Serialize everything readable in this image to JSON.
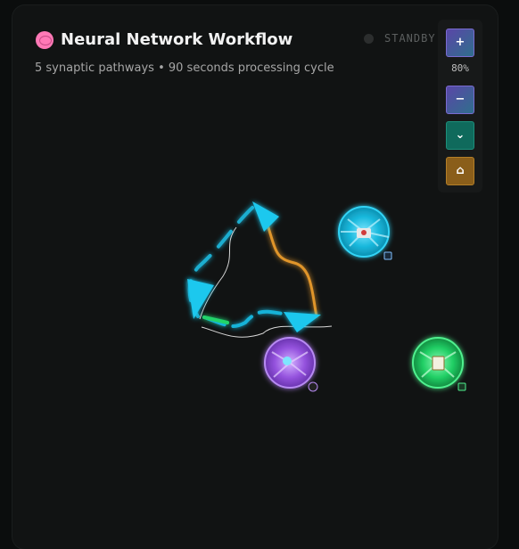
{
  "header": {
    "icon": "brain-icon",
    "title": "Neural Network Workflow",
    "subtitle": "5 synaptic pathways • 90 seconds processing cycle"
  },
  "status": {
    "label": "STANDBY",
    "dot_color": "#2c2e2e"
  },
  "zoom": {
    "zoom_in_label": "+",
    "zoom_level": "80%",
    "zoom_out_label": "−",
    "fit_label": "⌄",
    "home_label": "⌂"
  },
  "nodes": [
    {
      "name": "camera-node",
      "icon": "camera-icon",
      "color": "#1fc1e6",
      "badge_icon": "film-icon"
    },
    {
      "name": "search-node",
      "icon": "search-icon",
      "color": "#9b5ce0",
      "badge_icon": "magnifier-icon"
    },
    {
      "name": "clipboard-node",
      "icon": "clipboard-icon",
      "color": "#22d46a",
      "badge_icon": "note-icon"
    }
  ],
  "colors": {
    "background": "#0b0d0d",
    "panel": "#111313",
    "accent_cyan": "#1ec8ee",
    "accent_orange": "#e0952a",
    "accent_green": "#22d46a",
    "accent_purple": "#9b5ce0"
  }
}
